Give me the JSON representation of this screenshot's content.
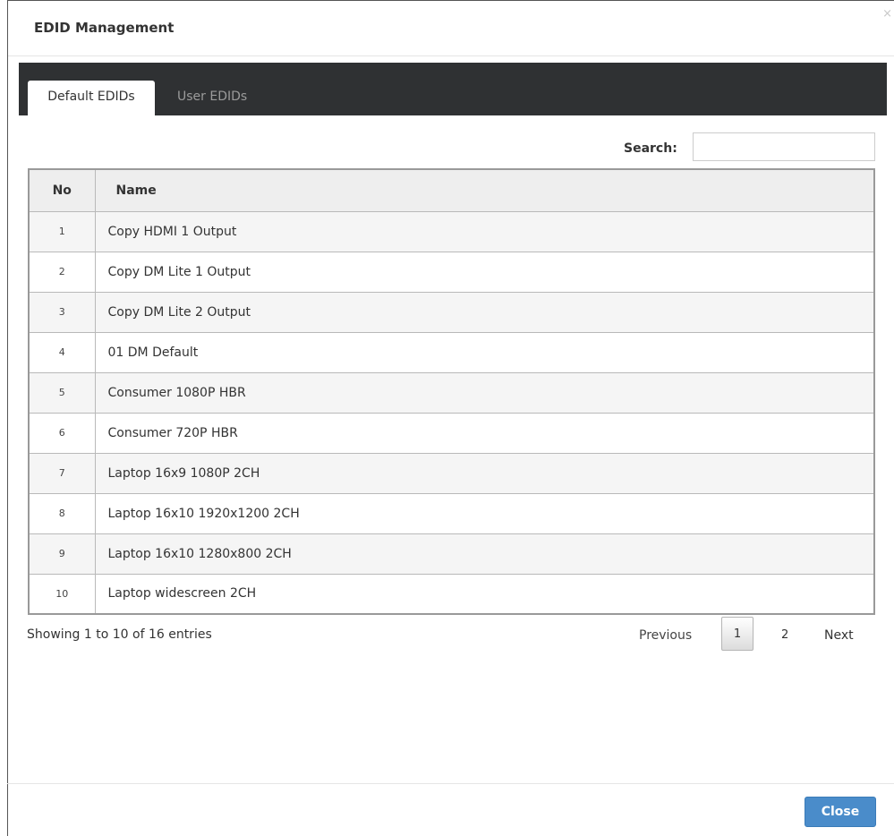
{
  "modal": {
    "title": "EDID Management",
    "close_glyph": "×"
  },
  "tabs": [
    {
      "label": "Default EDIDs",
      "active": true
    },
    {
      "label": "User EDIDs",
      "active": false
    }
  ],
  "search": {
    "label": "Search:",
    "value": "",
    "placeholder": ""
  },
  "table": {
    "columns": [
      "No",
      "Name"
    ],
    "rows": [
      {
        "no": "1",
        "name": "Copy HDMI 1 Output"
      },
      {
        "no": "2",
        "name": "Copy DM Lite 1 Output"
      },
      {
        "no": "3",
        "name": "Copy DM Lite 2 Output"
      },
      {
        "no": "4",
        "name": "01 DM Default"
      },
      {
        "no": "5",
        "name": "Consumer 1080P HBR"
      },
      {
        "no": "6",
        "name": "Consumer 720P HBR"
      },
      {
        "no": "7",
        "name": "Laptop 16x9 1080P 2CH"
      },
      {
        "no": "8",
        "name": "Laptop 16x10 1920x1200 2CH"
      },
      {
        "no": "9",
        "name": "Laptop 16x10 1280x800 2CH"
      },
      {
        "no": "10",
        "name": "Laptop widescreen 2CH"
      }
    ]
  },
  "info": "Showing 1 to 10 of 16 entries",
  "pagination": {
    "previous": "Previous",
    "pages": [
      "1",
      "2"
    ],
    "current": "1",
    "next": "Next"
  },
  "footer": {
    "close_label": "Close"
  },
  "colors": {
    "tabbar_bg": "#2f3133",
    "primary_button": "#4a8cca",
    "row_odd": "#f5f5f5",
    "row_even": "#ffffff"
  }
}
